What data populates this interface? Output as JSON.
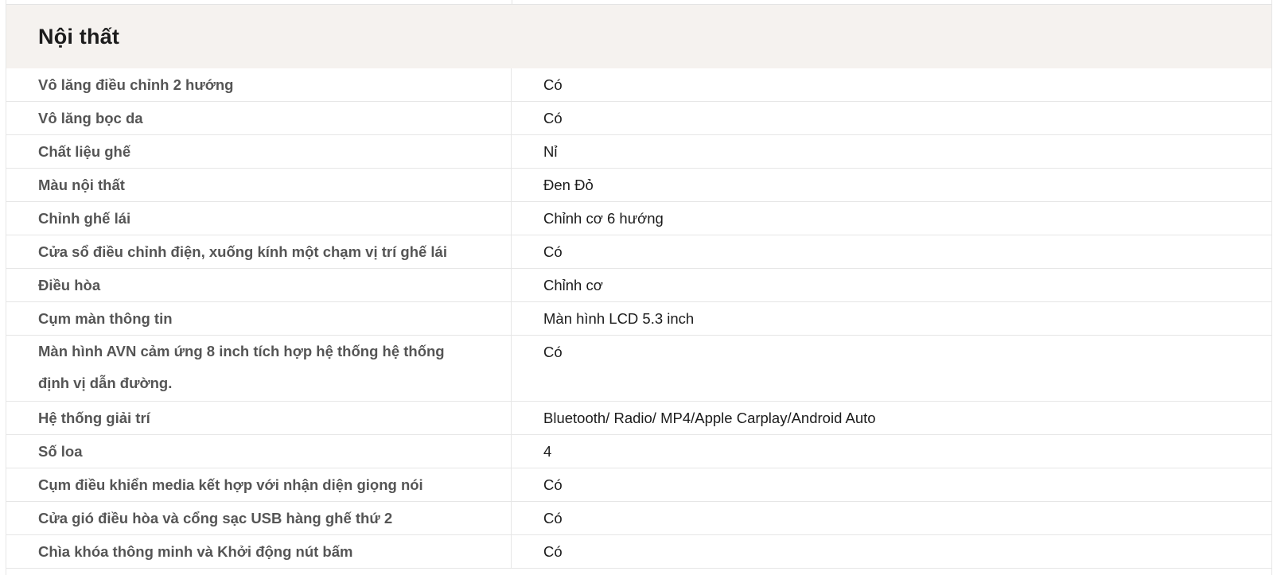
{
  "section": {
    "title": "Nội thất"
  },
  "rows": [
    {
      "label": "Vô lăng điều chỉnh 2 hướng",
      "value": "Có"
    },
    {
      "label": "Vô lăng bọc da",
      "value": "Có"
    },
    {
      "label": "Chất liệu ghế",
      "value": "Nỉ"
    },
    {
      "label": "Màu nội thất",
      "value": "Đen Đỏ"
    },
    {
      "label": "Chỉnh ghế lái",
      "value": "Chỉnh cơ 6 hướng"
    },
    {
      "label": "Cửa sổ điều chỉnh điện, xuống kính một chạm vị trí ghế lái",
      "value": "Có"
    },
    {
      "label": "Điều hòa",
      "value": "Chỉnh cơ"
    },
    {
      "label": "Cụm màn thông tin",
      "value": "Màn hình LCD 5.3 inch"
    },
    {
      "label": "Màn hình AVN cảm ứng 8 inch tích hợp hệ thống hệ thống định vị dẫn đường.",
      "value": "Có"
    },
    {
      "label": "Hệ thống giải trí",
      "value": "Bluetooth/ Radio/ MP4/Apple Carplay/Android Auto"
    },
    {
      "label": "Số loa",
      "value": "4"
    },
    {
      "label": "Cụm điều khiển media kết hợp với nhận diện giọng nói",
      "value": "Có"
    },
    {
      "label": "Cửa gió điều hòa và cổng sạc USB hàng ghế thứ 2",
      "value": "Có"
    },
    {
      "label": "Chìa khóa thông minh và Khởi động nút bấm",
      "value": "Có"
    }
  ]
}
